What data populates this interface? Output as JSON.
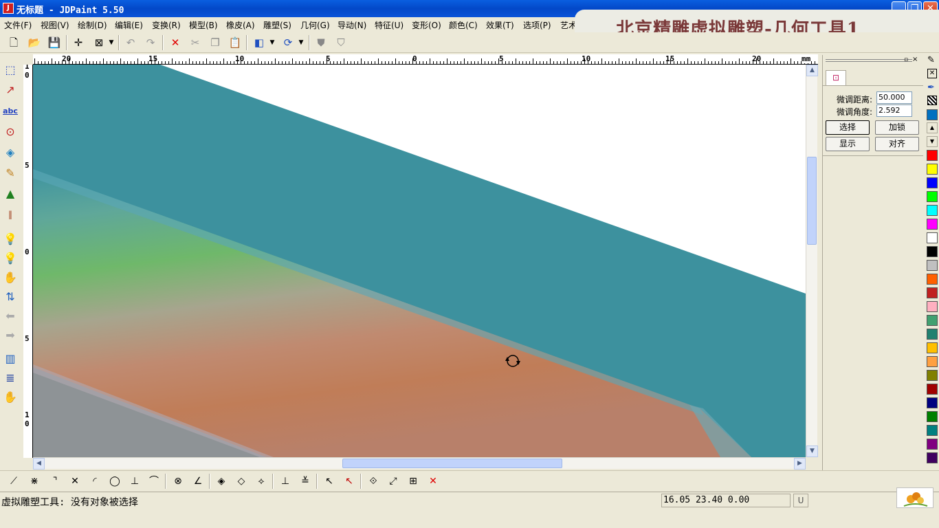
{
  "window": {
    "title": "无标题 - JDPaint 5.50",
    "app_icon_glyph": "J"
  },
  "banner": {
    "text": "北京精雕虚拟雕塑-几何工具1"
  },
  "menu": [
    "文件(F)",
    "视图(V)",
    "绘制(D)",
    "编辑(E)",
    "变换(R)",
    "模型(B)",
    "橡皮(A)",
    "雕塑(S)",
    "几何(G)",
    "导动(N)",
    "特征(U)",
    "变形(O)",
    "颜色(C)",
    "效果(T)",
    "选项(P)",
    "艺术"
  ],
  "ruler": {
    "unit": "mm",
    "top_labels": [
      "20",
      "15",
      "10",
      "5",
      "0",
      "5",
      "10",
      "15",
      "20"
    ],
    "left_labels": [
      "1\n0",
      "5",
      "0",
      "5",
      "1\n0"
    ]
  },
  "right_panel": {
    "distance_label": "微调距离:",
    "distance_value": "50.000",
    "angle_label": "微调角度:",
    "angle_value": "2.592",
    "buttons": {
      "select": "选择",
      "lock": "加锁",
      "show": "显示",
      "align": "对齐"
    }
  },
  "palette": [
    "#0070c0",
    "#ff0000",
    "#ffff00",
    "#0000ff",
    "#00ff00",
    "#00ffff",
    "#ff00ff",
    "#ffffff",
    "#000000",
    "#c0c0c0",
    "#ff6000",
    "#c02020",
    "#ffb0c0",
    "#40a070",
    "#208070",
    "#ffc000",
    "#ffa040",
    "#808000",
    "#a00000",
    "#000080",
    "#008000",
    "#008080",
    "#800080",
    "#400060"
  ],
  "status": {
    "message": "虚拟雕塑工具: 没有对象被选择",
    "coords": "16.05 23.40 0.00",
    "mode": "U"
  }
}
